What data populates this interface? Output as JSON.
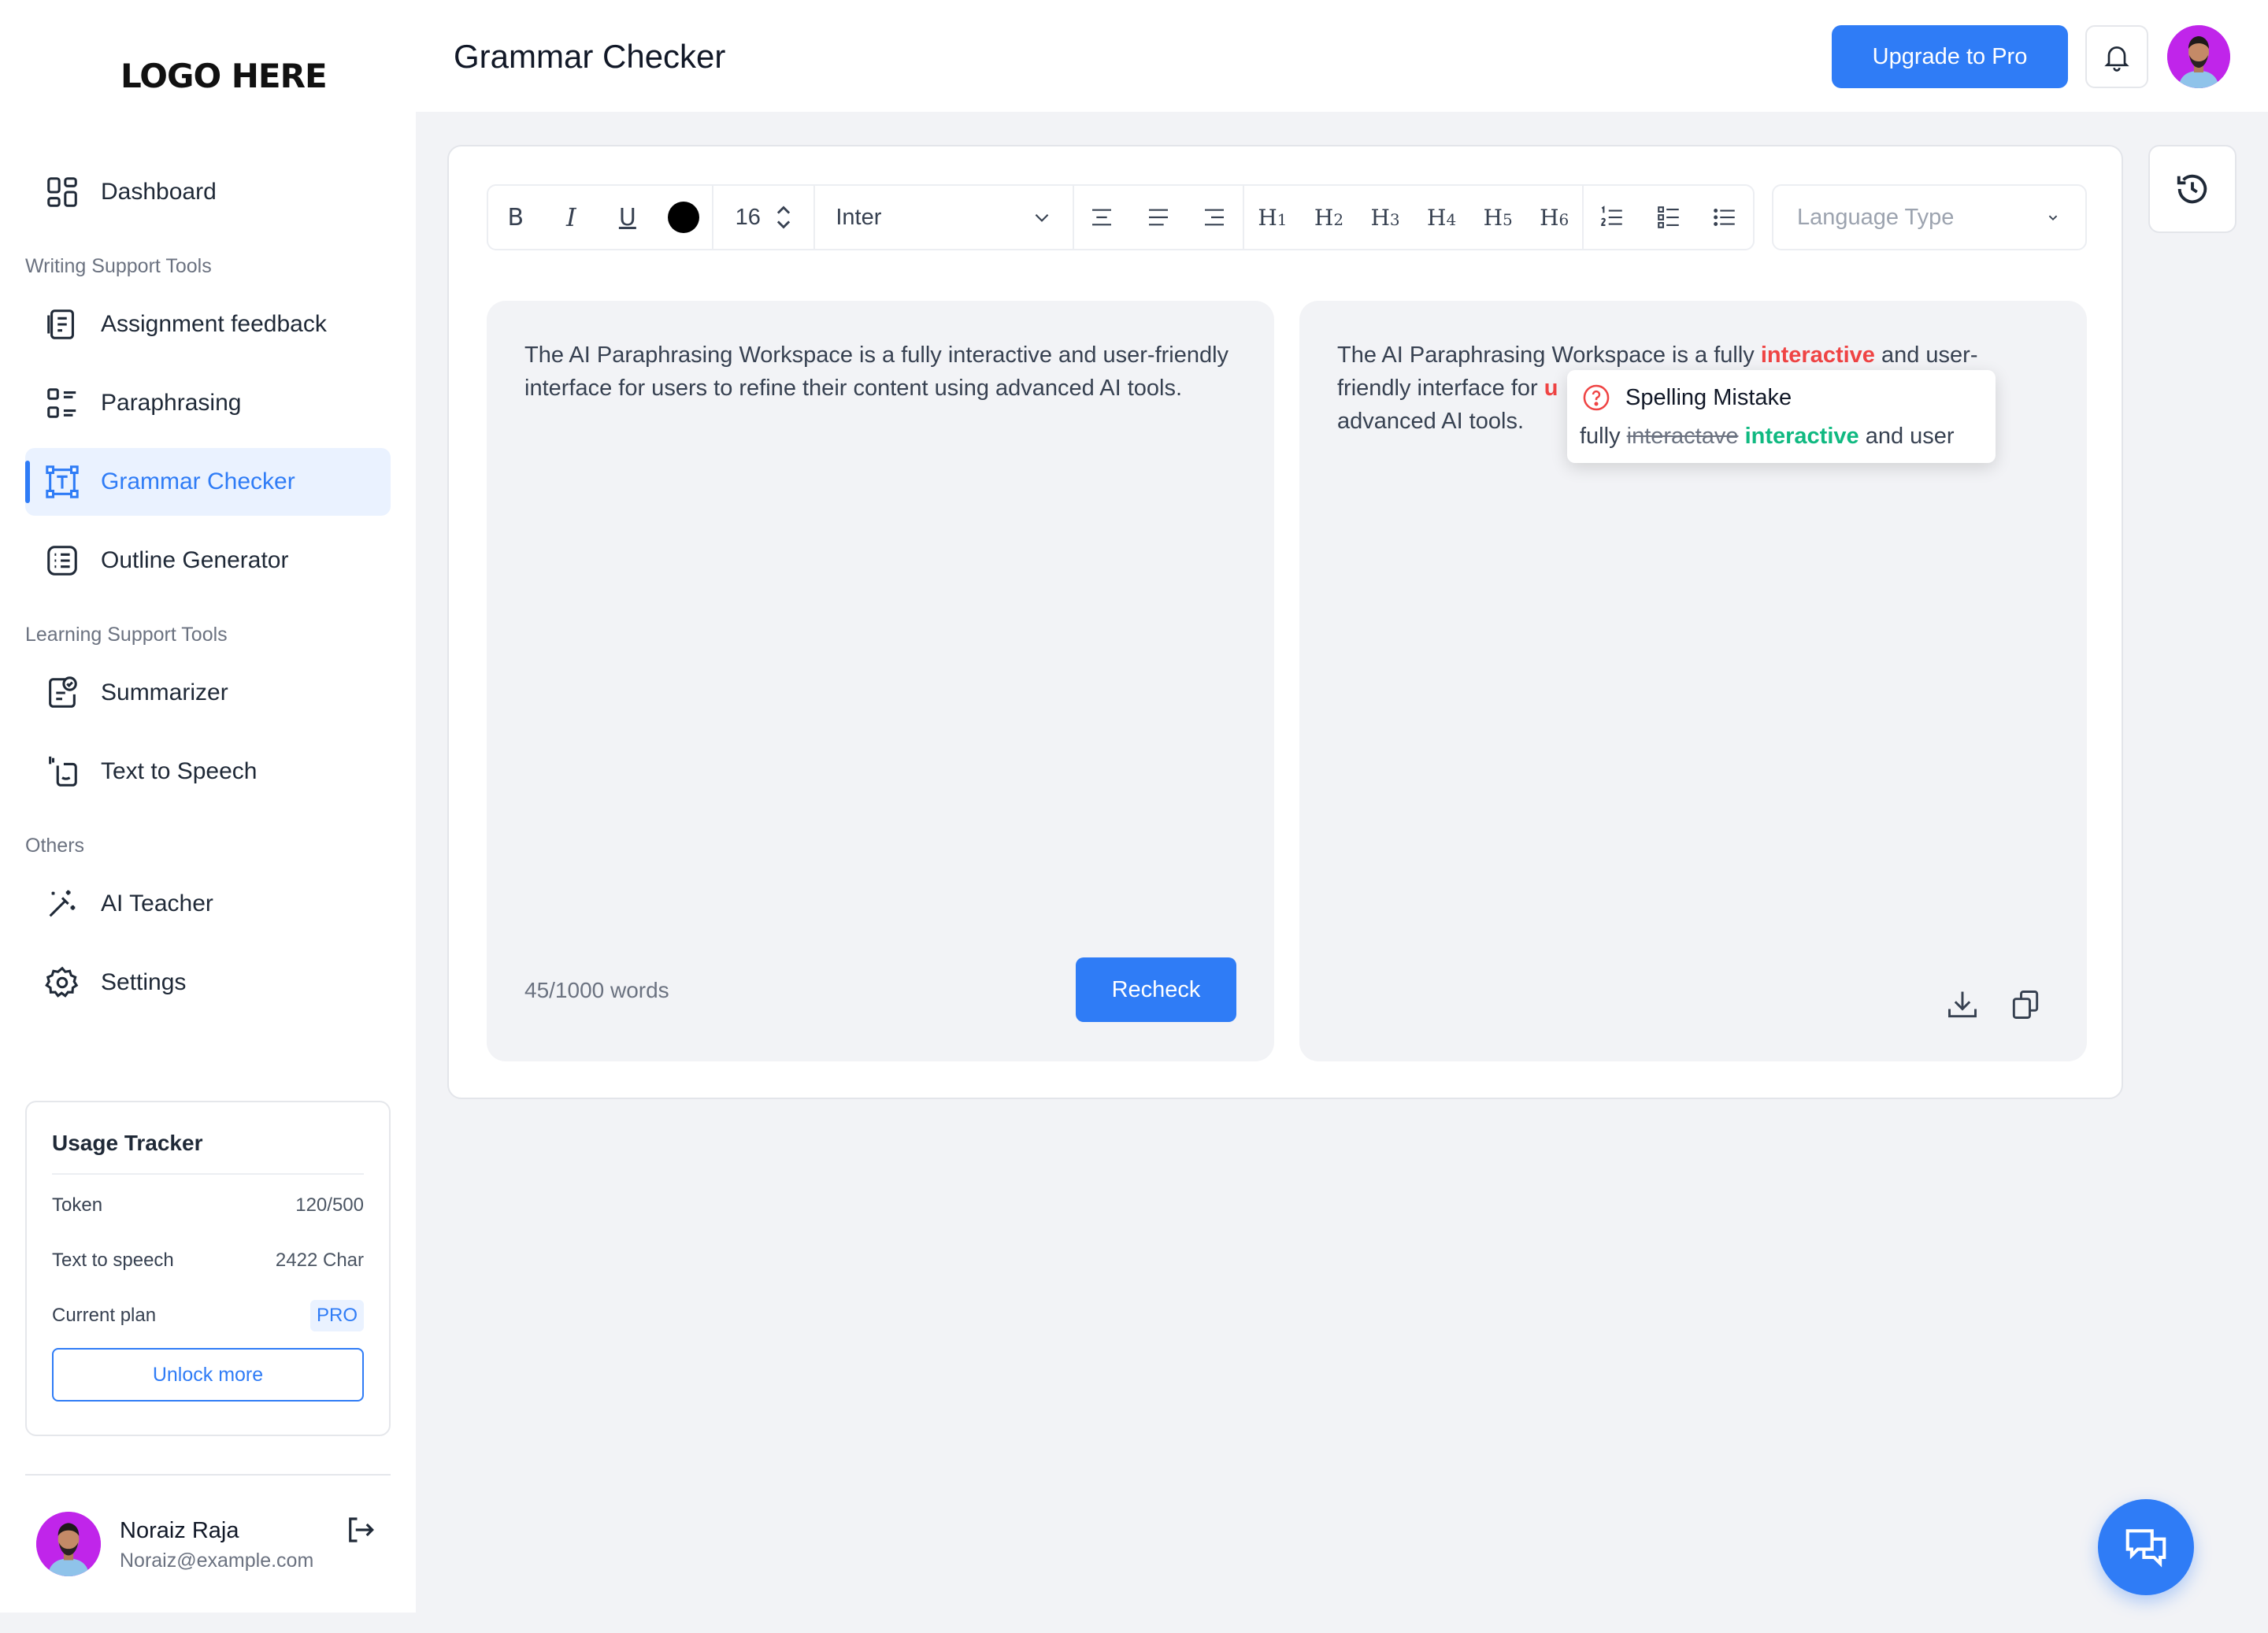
{
  "brand": {
    "logo_text": "LOGO HERE",
    "accent_color": "#2f7cf6"
  },
  "sidebar": {
    "nav": {
      "dashboard": "Dashboard",
      "assignment_feedback": "Assignment feedback",
      "paraphrasing": "Paraphrasing",
      "grammar_checker": "Grammar Checker",
      "outline_generator": "Outline Generator",
      "summarizer": "Summarizer",
      "text_to_speech": "Text to Speech",
      "ai_teacher": "AI Teacher",
      "settings": "Settings"
    },
    "sections": {
      "writing": "Writing Support Tools",
      "learning": "Learning Support Tools",
      "others": "Others"
    },
    "active_item": "grammar_checker",
    "usage": {
      "title": "Usage Tracker",
      "token_label": "Token",
      "token_value": "120/500",
      "tts_label": "Text to speech",
      "tts_value": "2422 Char",
      "plan_label": "Current plan",
      "plan_value": "PRO",
      "unlock_label": "Unlock more"
    },
    "user": {
      "name": "Noraiz Raja",
      "email": "Noraiz@example.com"
    }
  },
  "header": {
    "title": "Grammar Checker",
    "upgrade_label": "Upgrade to Pro"
  },
  "toolbar": {
    "bold": "B",
    "italic": "I",
    "underline": "U",
    "text_color": "#000000",
    "font_size": "16",
    "font_family": "Inter",
    "headings": [
      "H1",
      "H2",
      "H3",
      "H4",
      "H5",
      "H6"
    ],
    "language_placeholder": "Language Type"
  },
  "editor": {
    "input_text": "The AI Paraphrasing Workspace is a fully interactive and user-friendly interface for users to refine their content using advanced AI tools.",
    "word_count": "45/1000 words",
    "recheck_label": "Recheck"
  },
  "result": {
    "line1_before": "The AI Paraphrasing Workspace is a fully ",
    "line1_error": "interactive",
    "line1_after": " and user-",
    "line2": "friendly interface for ",
    "line2_fragment": "u",
    "line3": "advanced AI tools.",
    "error_color": "#ef4444"
  },
  "suggestion": {
    "title": "Spelling Mistake",
    "prefix": "fully ",
    "wrong": "interactave",
    "correct": "interactive",
    "suffix": " and user",
    "correct_color": "#10b981"
  }
}
